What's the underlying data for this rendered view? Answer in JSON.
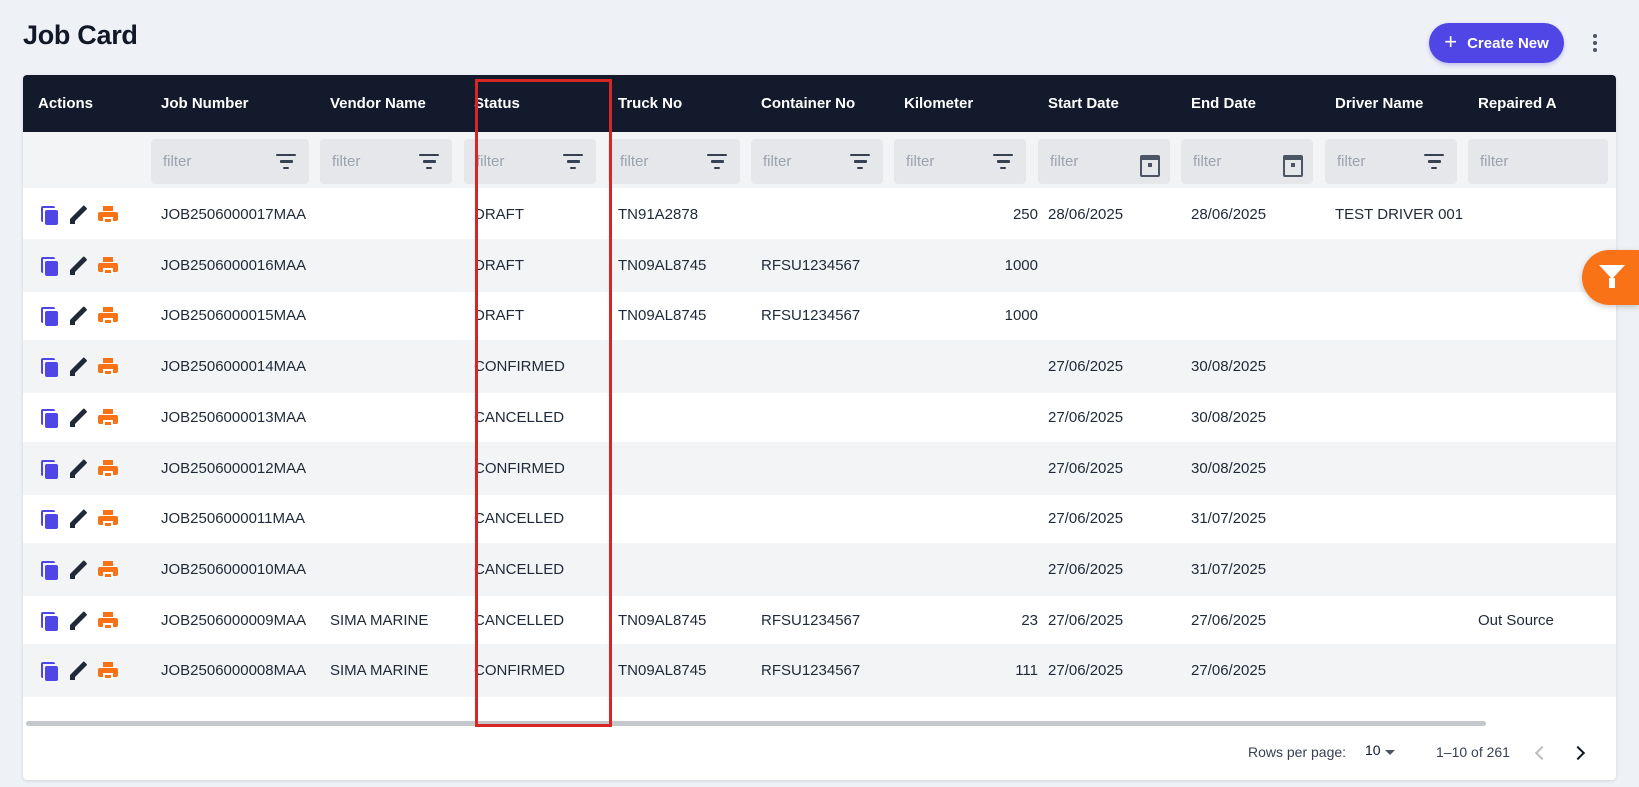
{
  "page": {
    "title": "Job Card"
  },
  "toolbar": {
    "create_label": "Create New",
    "create_icon": "plus-icon",
    "more_icon": "more-vertical-icon"
  },
  "table": {
    "columns": [
      "Actions",
      "Job Number",
      "Vendor Name",
      "Status",
      "Truck No",
      "Container No",
      "Kilometer",
      "Start Date",
      "End Date",
      "Driver Name",
      "Repaired A"
    ],
    "filter_placeholder": "filter",
    "row_actions": [
      "copy-icon",
      "edit-icon",
      "print-icon"
    ],
    "rows": [
      {
        "job": "JOB2506000017MAA",
        "vendor": "",
        "status": "DRAFT",
        "truck": "TN91A2878",
        "container": "",
        "km": "250",
        "start": "28/06/2025",
        "end": "28/06/2025",
        "driver": "TEST DRIVER 001",
        "repaired": ""
      },
      {
        "job": "JOB2506000016MAA",
        "vendor": "",
        "status": "DRAFT",
        "truck": "TN09AL8745",
        "container": "RFSU1234567",
        "km": "1000",
        "start": "",
        "end": "",
        "driver": "",
        "repaired": ""
      },
      {
        "job": "JOB2506000015MAA",
        "vendor": "",
        "status": "DRAFT",
        "truck": "TN09AL8745",
        "container": "RFSU1234567",
        "km": "1000",
        "start": "",
        "end": "",
        "driver": "",
        "repaired": ""
      },
      {
        "job": "JOB2506000014MAA",
        "vendor": "",
        "status": "CONFIRMED",
        "truck": "",
        "container": "",
        "km": "",
        "start": "27/06/2025",
        "end": "30/08/2025",
        "driver": "",
        "repaired": ""
      },
      {
        "job": "JOB2506000013MAA",
        "vendor": "",
        "status": "CANCELLED",
        "truck": "",
        "container": "",
        "km": "",
        "start": "27/06/2025",
        "end": "30/08/2025",
        "driver": "",
        "repaired": ""
      },
      {
        "job": "JOB2506000012MAA",
        "vendor": "",
        "status": "CONFIRMED",
        "truck": "",
        "container": "",
        "km": "",
        "start": "27/06/2025",
        "end": "30/08/2025",
        "driver": "",
        "repaired": ""
      },
      {
        "job": "JOB2506000011MAA",
        "vendor": "",
        "status": "CANCELLED",
        "truck": "",
        "container": "",
        "km": "",
        "start": "27/06/2025",
        "end": "31/07/2025",
        "driver": "",
        "repaired": ""
      },
      {
        "job": "JOB2506000010MAA",
        "vendor": "",
        "status": "CANCELLED",
        "truck": "",
        "container": "",
        "km": "",
        "start": "27/06/2025",
        "end": "31/07/2025",
        "driver": "",
        "repaired": ""
      },
      {
        "job": "JOB2506000009MAA",
        "vendor": "SIMA MARINE",
        "status": "CANCELLED",
        "truck": "TN09AL8745",
        "container": "RFSU1234567",
        "km": "23",
        "start": "27/06/2025",
        "end": "27/06/2025",
        "driver": "",
        "repaired": "Out Source"
      },
      {
        "job": "JOB2506000008MAA",
        "vendor": "SIMA MARINE",
        "status": "CONFIRMED",
        "truck": "TN09AL8745",
        "container": "RFSU1234567",
        "km": "111",
        "start": "27/06/2025",
        "end": "27/06/2025",
        "driver": "",
        "repaired": ""
      }
    ]
  },
  "pagination": {
    "rows_per_page_label": "Rows per page:",
    "rows_per_page": "10",
    "range": "1–10 of 261"
  },
  "colors": {
    "accent": "#4f46e5",
    "header_bg": "#121a2b",
    "action_orange": "#f97316",
    "highlight": "#d62626"
  }
}
